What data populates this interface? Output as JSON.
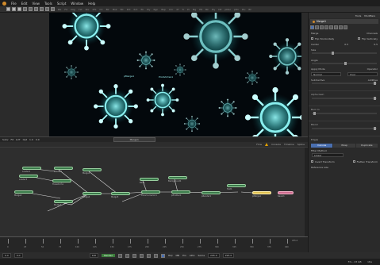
{
  "menu": [
    "File",
    "Edit",
    "View",
    "Tools",
    "Script",
    "Window",
    "Help"
  ],
  "toolbar": {
    "buttons": [
      "new",
      "open",
      "save",
      "undo",
      "redo",
      "layout1",
      "layout2",
      "layout3",
      "layout4"
    ],
    "tools": [
      "BG",
      "FX",
      "Mrg",
      "Txt",
      "Bol",
      "XfS",
      "CC",
      "Blr",
      "Msk",
      "BC",
      "Pnt",
      "Rct",
      "Ell",
      "Ply",
      "Rgn",
      "Bsp",
      "CCr",
      "Xf",
      "Tr",
      "Pl",
      "Mg",
      "Plt",
      "Bk",
      "Ply"
    ],
    "tools_right": [
      "DP",
      "pMer",
      "pRn",
      "Plu",
      "Bf"
    ]
  },
  "viewer": {
    "label_a": "pMerge1",
    "label_b": "ProbVortex1"
  },
  "viewer_status": {
    "zoom": "Subv",
    "fit": "Fit",
    "lut": "LUT",
    "view": "Opt",
    "node_name": "Merge1",
    "value_a": "1.0",
    "value_b": "0.0"
  },
  "flow_header": {
    "items": [
      "Flow",
      "Console",
      "Timeline",
      "Spline"
    ],
    "warning_icon": "warning-icon"
  },
  "flow": {
    "nodes": [
      "Loader1",
      "Loader2",
      "Loader3",
      "Transform1",
      "Merge1",
      "Merge2",
      "Merge3",
      "Merge4",
      "Merge5",
      "Blur1",
      "ColorCorrector1",
      "Background1",
      "pEmitter1",
      "pRender1",
      "Text1",
      "pMerge1",
      "Saver1"
    ]
  },
  "timeline": {
    "ticks": [
      "0",
      "25",
      "50",
      "75",
      "100",
      "125",
      "150",
      "175",
      "200",
      "225",
      "250",
      "275",
      "300",
      "325",
      "350",
      "375",
      "400"
    ],
    "end_value": "295.0"
  },
  "transport": {
    "start": "0.0",
    "current": "0.0",
    "render_label": "Render",
    "hiq": "HiQ",
    "mb": "MB",
    "prx": "Prx",
    "aprx": "APrx",
    "some": "Some",
    "end_a": "295.0",
    "end_b": "295.0",
    "frame_a": "100"
  },
  "status": {
    "memory": "5% - 23 GB",
    "state": "Idle"
  },
  "inspector": {
    "tabs": [
      "Tools",
      "Modifiers"
    ],
    "node_name": "Merge1",
    "merge_label": "Merge",
    "channels_label": "Channels",
    "flip_h": "Flip Horizontally",
    "flip_v": "Flip Vertically",
    "center_label": "Center",
    "center_x": "0.5",
    "center_y": "0.5",
    "size_label": "Size",
    "angle_label": "Angle",
    "apply_mode_label": "Apply Mode",
    "operator_label": "Operator",
    "apply_mode_value": "Normal",
    "operator_value": "Over",
    "subtractive": "Subtractive",
    "additive": "Additive",
    "alpha_gain": "Alpha Gain",
    "burn_in": "Burn In",
    "blend": "Blend",
    "edges_label": "Edges",
    "edge_modes": [
      "Canvas",
      "Wrap",
      "Duplicate"
    ],
    "filter_method_label": "Filter Method",
    "filter_value": "Linear",
    "invert_transform": "Invert Transform",
    "flatten_transform": "Flatten Transform",
    "reference_size": "Reference size"
  },
  "colors": {
    "viewer_glow": "#5fd0e0",
    "node_green": "#3a7a4a",
    "node_selected": "#e0c050",
    "node_output": "#cc6b8e",
    "accent_blue": "#4a6fb0"
  }
}
